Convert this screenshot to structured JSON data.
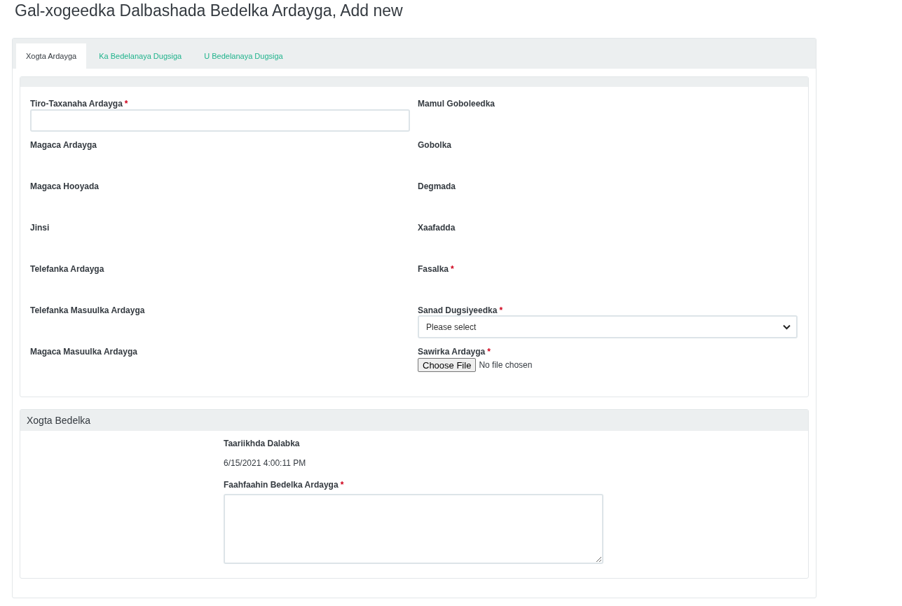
{
  "page_title": "Gal-xogeedka Dalbashada Bedelka Ardayga, Add new",
  "tabs": [
    {
      "label": "Xogta Ardayga",
      "selected": true
    },
    {
      "label": "Ka Bedelanaya Dugsiga",
      "selected": false
    },
    {
      "label": "U Bedelanaya Dugsiga",
      "selected": false
    }
  ],
  "student_info": {
    "left_fields": [
      {
        "label": "Tiro-Taxanaha Ardayga",
        "required_mark": "*",
        "kind": "text"
      },
      {
        "label": "Magaca Ardayga",
        "kind": "label"
      },
      {
        "label": "Magaca Hooyada",
        "kind": "label"
      },
      {
        "label": "Jinsi",
        "kind": "label"
      },
      {
        "label": "Telefanka Ardayga",
        "kind": "label"
      },
      {
        "label": "Telefanka Masuulka Ardayga",
        "kind": "label"
      },
      {
        "label": "Magaca Masuulka Ardayga",
        "kind": "label"
      }
    ],
    "right_fields": [
      {
        "label": "Mamul Goboleedka",
        "kind": "label"
      },
      {
        "label": "Gobolka",
        "kind": "label"
      },
      {
        "label": "Degmada",
        "kind": "label"
      },
      {
        "label": "Xaafadda",
        "kind": "label"
      },
      {
        "label": "Fasalka",
        "required_mark": "*",
        "kind": "label"
      },
      {
        "label": "Sanad Dugsiyeedka",
        "required_mark": "*",
        "kind": "select",
        "value": "Please select"
      },
      {
        "label": "Sawirka Ardayga",
        "required_mark": "*",
        "kind": "file",
        "button": "Choose File",
        "status": "No file chosen"
      }
    ]
  },
  "transfer_info": {
    "title": "Xogta Bedelka",
    "fields": [
      {
        "label": "Taariikhda Dalabka",
        "kind": "value",
        "value": "6/15/2021 4:00:11 PM"
      },
      {
        "label": "Faahfaahin Bedelka Ardayga",
        "required_mark": "*",
        "kind": "textarea"
      }
    ]
  }
}
